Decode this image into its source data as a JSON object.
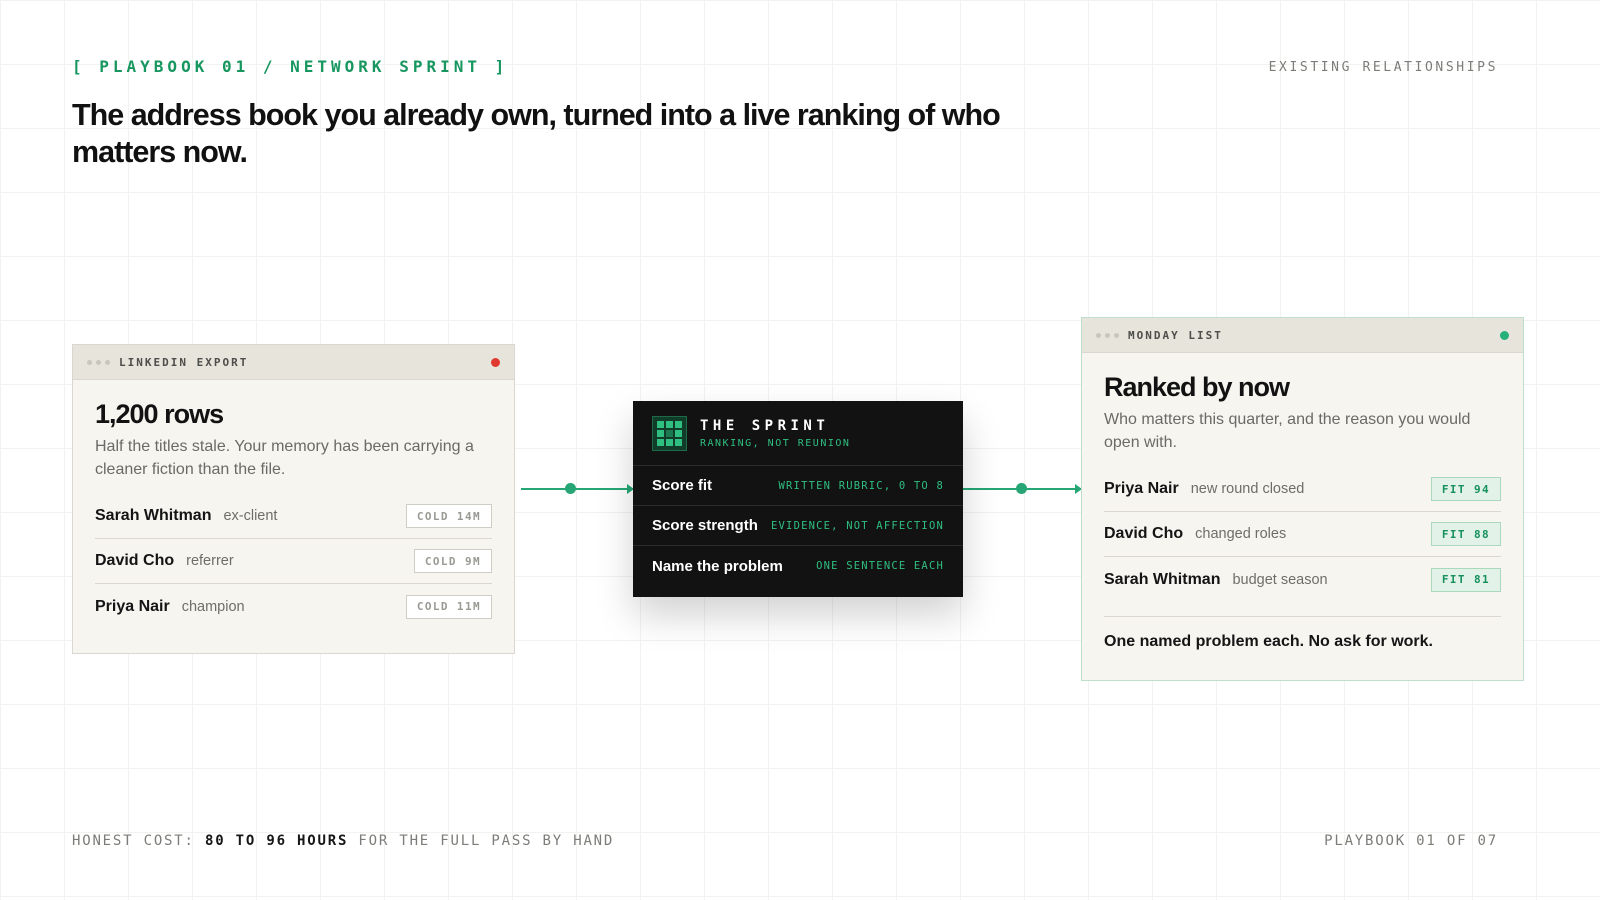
{
  "header": {
    "eyebrow": "[ PLAYBOOK 01 / NETWORK SPRINT ]",
    "tag": "EXISTING RELATIONSHIPS",
    "headline": "The address book you already own, turned into a live ranking of who matters now."
  },
  "source_card": {
    "bar_label": "LINKEDIN EXPORT",
    "status_color": "#e03a30",
    "title": "1,200 rows",
    "desc": "Half the titles stale. Your memory has been carrying a cleaner fiction than the file.",
    "rows": [
      {
        "name": "Sarah Whitman",
        "role": "ex-client",
        "badge": "COLD 14M"
      },
      {
        "name": "David Cho",
        "role": "referrer",
        "badge": "COLD 9M"
      },
      {
        "name": "Priya Nair",
        "role": "champion",
        "badge": "COLD 11M"
      }
    ]
  },
  "sprint": {
    "icon": "grid-icon",
    "title": "THE SPRINT",
    "subtitle": "RANKING, NOT REUNION",
    "steps": [
      {
        "label": "Score fit",
        "value": "WRITTEN RUBRIC, 0 TO 8"
      },
      {
        "label": "Score strength",
        "value": "EVIDENCE, NOT AFFECTION"
      },
      {
        "label": "Name the problem",
        "value": "ONE SENTENCE EACH"
      }
    ]
  },
  "result_card": {
    "bar_label": "MONDAY LIST",
    "status_color": "#26b07a",
    "title": "Ranked by now",
    "desc": "Who matters this quarter, and the reason you would open with.",
    "rows": [
      {
        "name": "Priya Nair",
        "role": "new round closed",
        "badge": "FIT 94"
      },
      {
        "name": "David Cho",
        "role": "changed roles",
        "badge": "FIT 88"
      },
      {
        "name": "Sarah Whitman",
        "role": "budget season",
        "badge": "FIT 81"
      }
    ],
    "footer": "One named problem each. No ask for work."
  },
  "footer": {
    "cost_prefix": "HONEST COST:",
    "cost_value": "80 TO 96 HOURS",
    "cost_suffix": "FOR THE FULL PASS BY HAND",
    "page": "PLAYBOOK 01 OF 07"
  },
  "colors": {
    "accent": "#17975f",
    "alert": "#e03a30",
    "panel": "#121212"
  }
}
